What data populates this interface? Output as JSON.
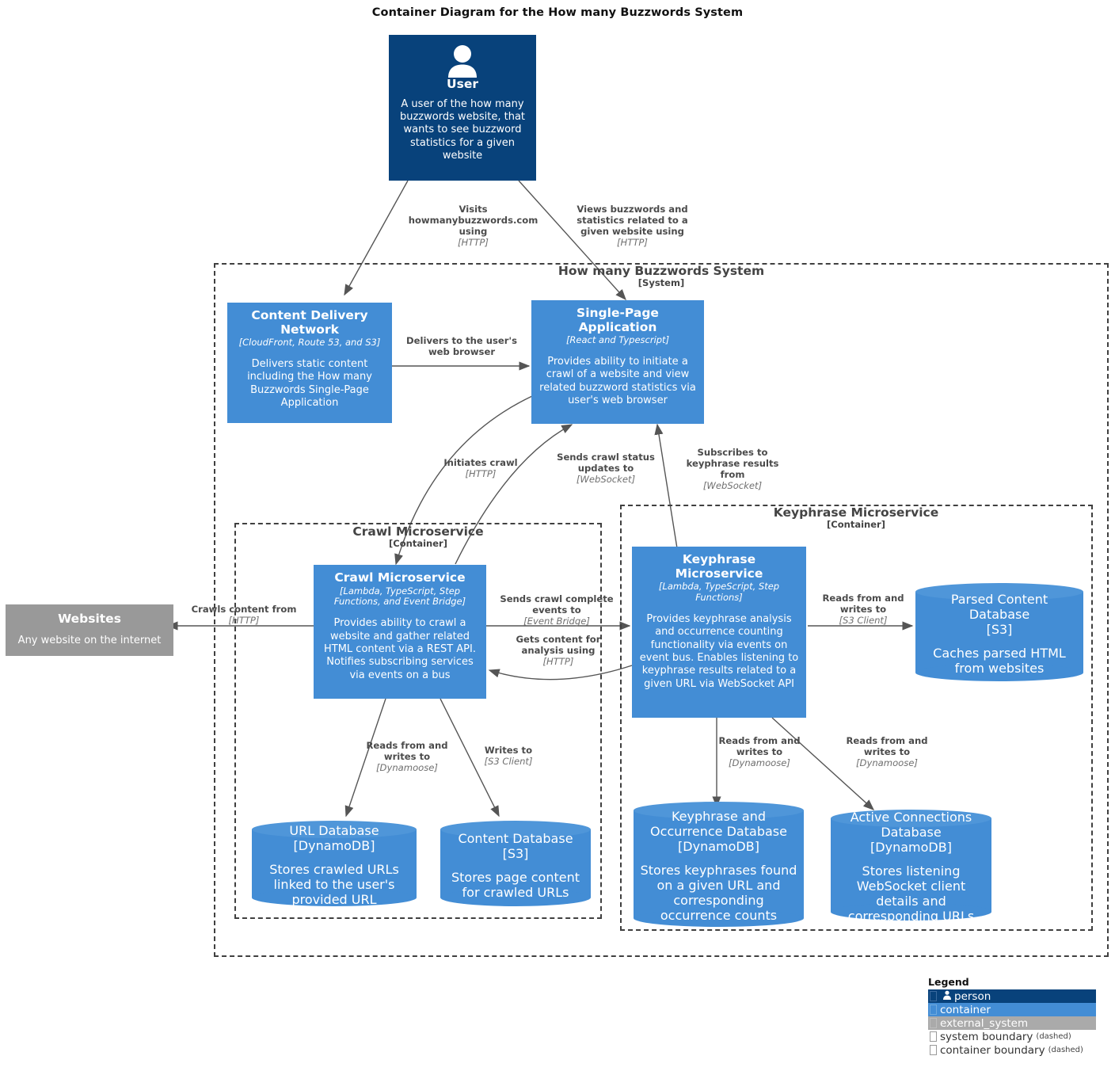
{
  "title": "Container Diagram for the How many Buzzwords System",
  "colors": {
    "person": "#08427b",
    "container": "#438dd5",
    "external_system": "#999999",
    "boundary": "#404040",
    "edge": "#555555",
    "label_text": "#4b4b4b"
  },
  "boundaries": [
    {
      "name": "How many Buzzwords System",
      "type": "[System]"
    },
    {
      "name": "Crawl Microservice",
      "type": "[Container]"
    },
    {
      "name": "Keyphrase Microservice",
      "type": "[Container]"
    }
  ],
  "nodes": {
    "user": {
      "title": "User",
      "tech": "",
      "desc": "A user of the how many buzzwords website, that wants to see buzzword statistics for a given website",
      "icon": "person-icon",
      "kind": "person"
    },
    "cdn": {
      "title": "Content Delivery Network",
      "tech": "[CloudFront, Route 53, and S3]",
      "desc": "Delivers static content including the How many Buzzwords Single-Page Application",
      "kind": "container"
    },
    "spa": {
      "title": "Single-Page Application",
      "tech": "[React and Typescript]",
      "desc": "Provides ability to initiate a crawl of a website and view related buzzword statistics via user's web browser",
      "kind": "container"
    },
    "websites": {
      "title": "Websites",
      "tech": "",
      "desc": "Any website on the internet",
      "kind": "external_system"
    },
    "crawl_ms": {
      "title": "Crawl Microservice",
      "tech": "[Lambda, TypeScript, Step Functions, and Event Bridge]",
      "desc": "Provides ability to crawl a website and gather related HTML content via a REST API. Notifies subscribing services via events on a bus",
      "kind": "container"
    },
    "keyphrase_ms": {
      "title": "Keyphrase Microservice",
      "tech": "[Lambda, TypeScript, Step Functions]",
      "desc": "Provides keyphrase analysis and occurrence counting functionality via events on event bus. Enables listening to keyphrase results related to a given URL via WebSocket API",
      "kind": "container"
    },
    "url_db": {
      "title": "URL Database",
      "tech": "[DynamoDB]",
      "desc": "Stores crawled URLs linked to the user's provided URL",
      "kind": "database"
    },
    "content_db": {
      "title": "Content Database",
      "tech": "[S3]",
      "desc": "Stores page content for crawled URLs",
      "kind": "database"
    },
    "parsed_content_db": {
      "title": "Parsed Content Database",
      "tech": "[S3]",
      "desc": "Caches parsed HTML from websites",
      "kind": "database"
    },
    "keyphrase_db": {
      "title": "Keyphrase and Occurrence Database",
      "tech": "[DynamoDB]",
      "desc": "Stores keyphrases found on a given URL and corresponding occurrence counts",
      "kind": "database"
    },
    "connections_db": {
      "title": "Active Connections Database",
      "tech": "[DynamoDB]",
      "desc": "Stores listening WebSocket client details and corresponding URLs",
      "kind": "database"
    }
  },
  "edges": [
    {
      "id": "user-cdn",
      "main": "Visits howmanybuzzwords.com using",
      "tech": "[HTTP]"
    },
    {
      "id": "user-spa",
      "main": "Views buzzwords and statistics related to a given website using",
      "tech": "[HTTP]"
    },
    {
      "id": "cdn-spa",
      "main": "Delivers to the user's web browser",
      "tech": ""
    },
    {
      "id": "spa-crawl",
      "main": "Initiates crawl",
      "tech": "[HTTP]"
    },
    {
      "id": "crawl-spa",
      "main": "Sends crawl status updates to",
      "tech": "[WebSocket]"
    },
    {
      "id": "keyphrase-spa",
      "main": "Subscribes to keyphrase results from",
      "tech": "[WebSocket]"
    },
    {
      "id": "crawl-websites",
      "main": "Crawls content from",
      "tech": "[HTTP]"
    },
    {
      "id": "crawl-keyphrase",
      "main": "Sends crawl complete events to",
      "tech": "[Event Bridge]"
    },
    {
      "id": "keyphrase-crawl",
      "main": "Gets content for analysis using",
      "tech": "[HTTP]"
    },
    {
      "id": "crawl-urldb",
      "main": "Reads from and writes to",
      "tech": "[Dynamoose]"
    },
    {
      "id": "crawl-contentdb",
      "main": "Writes to",
      "tech": "[S3 Client]"
    },
    {
      "id": "keyphrase-parseddb",
      "main": "Reads from and writes to",
      "tech": "[S3 Client]"
    },
    {
      "id": "keyphrase-keyphrasedb",
      "main": "Reads from and writes to",
      "tech": "[Dynamoose]"
    },
    {
      "id": "keyphrase-connectionsdb",
      "main": "Reads from and writes to",
      "tech": "[Dynamoose]"
    }
  ],
  "legend": {
    "heading": "Legend",
    "items": [
      {
        "label": "person",
        "swatch": "person",
        "icon": "person-icon"
      },
      {
        "label": "container",
        "swatch": "container",
        "icon": ""
      },
      {
        "label": "external_system",
        "swatch": "external_system",
        "icon": ""
      },
      {
        "label": "system boundary",
        "note": "(dashed)",
        "swatch": "none",
        "icon": ""
      },
      {
        "label": "container boundary",
        "note": "(dashed)",
        "swatch": "none",
        "icon": ""
      }
    ]
  }
}
